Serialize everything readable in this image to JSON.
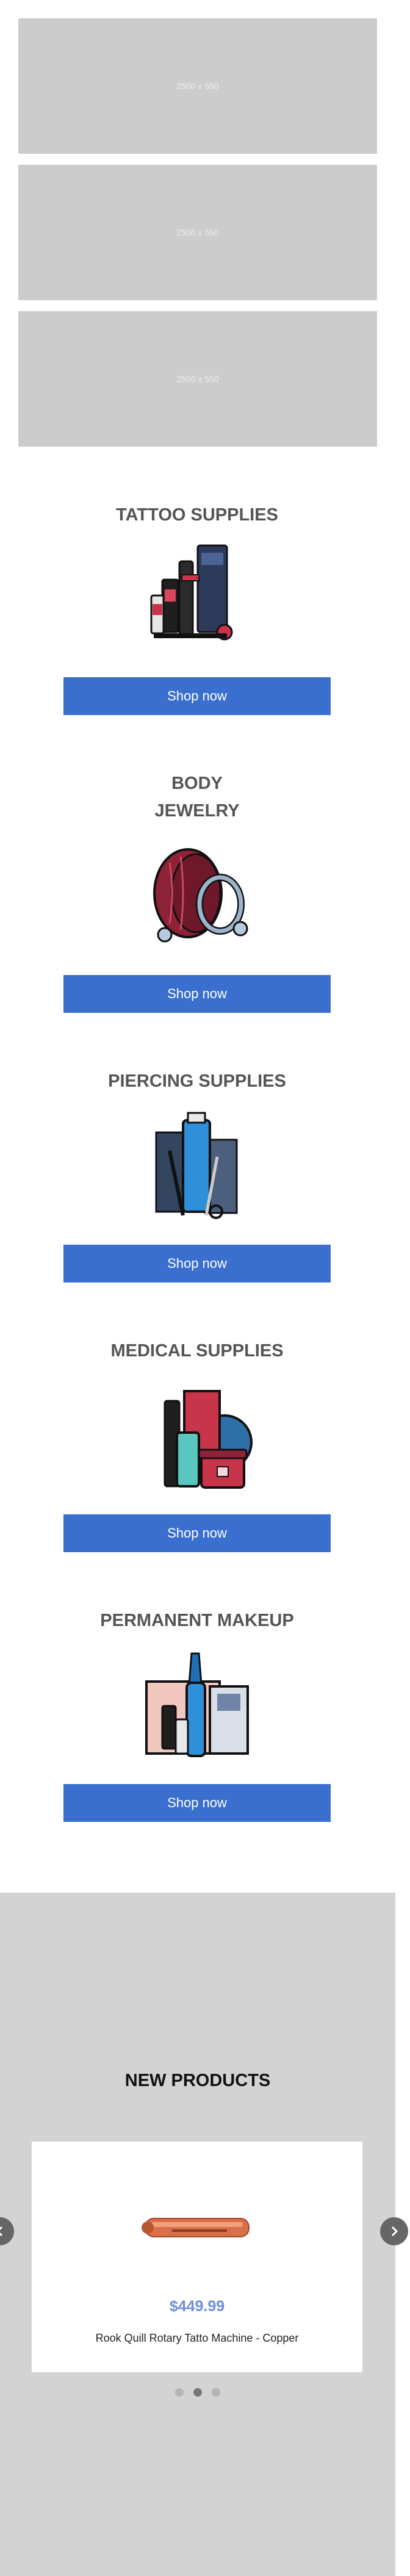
{
  "banners": [
    {
      "placeholder": "2500 x 550"
    },
    {
      "placeholder": "2500 x 550"
    },
    {
      "placeholder": "2500 x 550"
    }
  ],
  "categories": [
    {
      "title": "TATTOO SUPPLIES",
      "button": "Shop now",
      "icon": "tattoo-supplies-icon"
    },
    {
      "title": "BODY\nJEWELRY",
      "button": "Shop now",
      "icon": "body-jewelry-icon"
    },
    {
      "title": "PIERCING SUPPLIES",
      "button": "Shop now",
      "icon": "piercing-supplies-icon"
    },
    {
      "title": "MEDICAL SUPPLIES",
      "button": "Shop now",
      "icon": "medical-supplies-icon"
    },
    {
      "title": "PERMANENT MAKEUP",
      "button": "Shop now",
      "icon": "permanent-makeup-icon"
    }
  ],
  "new_products": {
    "title": "NEW PRODUCTS",
    "product": {
      "price": "$449.99",
      "name": "Rook Quill Rotary Tatto Machine - Copper",
      "image_icon": "copper-tattoo-machine-icon"
    },
    "prev_icon": "chevron-left-icon",
    "next_icon": "chevron-right-icon",
    "pagination": {
      "count": 3,
      "active": 2
    }
  },
  "colors": {
    "button": "#3a6fcf",
    "price": "#6d8ee0",
    "placeholder": "#cccccc",
    "section_bg": "#d3d3d3"
  }
}
